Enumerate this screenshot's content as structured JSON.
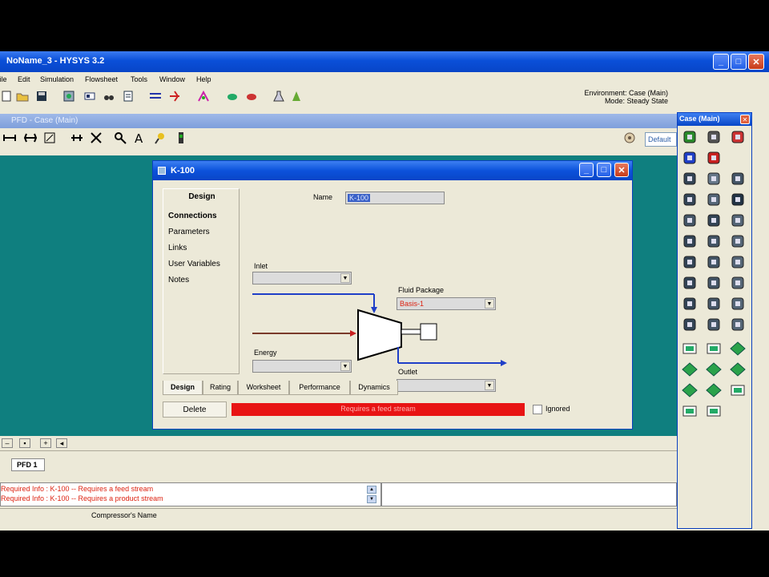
{
  "app": {
    "title": "NoName_3 - HYSYS 3.2",
    "min": "_",
    "max": "□",
    "close": "✕"
  },
  "menu": [
    "File",
    "Edit",
    "Simulation",
    "Flowsheet",
    "Tools",
    "Window",
    "Help"
  ],
  "environment": {
    "line1": "Environment: Case (Main)",
    "line2": "Mode: Steady State"
  },
  "pfd": {
    "title": "PFD - Case (Main)",
    "default_label": "Default"
  },
  "dialog": {
    "title": "K-100",
    "name_label": "Name",
    "name_value": "K-100",
    "nav_header": "Design",
    "nav_items": [
      "Connections",
      "Parameters",
      "Links",
      "User Variables",
      "Notes"
    ],
    "inlet_label": "Inlet",
    "energy_label": "Energy",
    "fluid_package_label": "Fluid Package",
    "fluid_package_value": "Basis-1",
    "outlet_label": "Outlet",
    "tabs": [
      "Design",
      "Rating",
      "Worksheet",
      "Performance",
      "Dynamics"
    ],
    "delete_label": "Delete",
    "status_text": "Requires a feed stream",
    "ignored_label": "Ignored"
  },
  "pfd_tab": "PFD 1",
  "messages": [
    "Required Info : K-100 -- Requires a feed stream",
    "Required Info : K-100 -- Requires a product stream"
  ],
  "statusbar_text": "Compressor's Name",
  "palette": {
    "title": "Case (Main)"
  },
  "colors": {
    "canvas": "#0f7f7f",
    "title_blue": "#0a4fd8",
    "error_red": "#e81414",
    "stream_blue": "#1f3fc8",
    "energy_red": "#c82020"
  }
}
